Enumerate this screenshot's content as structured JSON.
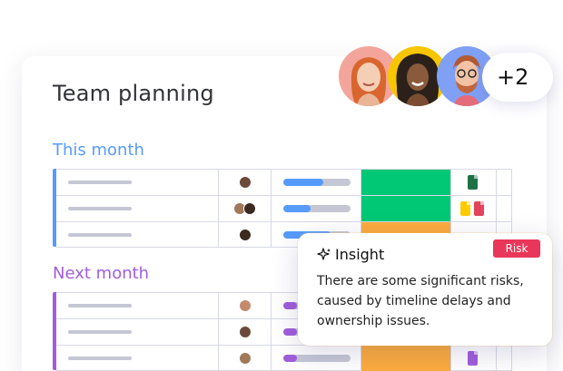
{
  "board": {
    "title": "Team planning"
  },
  "team": {
    "extra_count": "+2",
    "members": [
      {
        "icon": "woman-redhead-avatar",
        "bg": "#f3a59c"
      },
      {
        "icon": "woman-curly-avatar",
        "bg": "#f7c600"
      },
      {
        "icon": "man-glasses-avatar",
        "bg": "#7fa0f5"
      }
    ]
  },
  "groups": [
    {
      "label": "This month",
      "accent": "#579bfc",
      "rows": [
        {
          "owners": 1,
          "progress": 0.6,
          "progress_color": "#579bfc",
          "status_color": "#00c875",
          "files": [
            "#1e7145"
          ]
        },
        {
          "owners": 2,
          "progress": 0.4,
          "progress_color": "#579bfc",
          "status_color": "#00c875",
          "files": [
            "#ffcb00",
            "#e2445c"
          ]
        },
        {
          "owners": 1,
          "progress": 0.7,
          "progress_color": "#579bfc",
          "status_color": "#fdab3d",
          "files": []
        }
      ]
    },
    {
      "label": "Next month",
      "accent": "#a25ddc",
      "rows": [
        {
          "owners": 1,
          "progress": 0.2,
          "progress_color": "#a25ddc",
          "status_color": "#ffffff",
          "files": []
        },
        {
          "owners": 1,
          "progress": 0.2,
          "progress_color": "#a25ddc",
          "status_color": "#ffffff",
          "files": []
        },
        {
          "owners": 1,
          "progress": 0.2,
          "progress_color": "#a25ddc",
          "status_color": "#fdab3d",
          "files": [
            "#a25ddc"
          ]
        }
      ]
    }
  ],
  "insight": {
    "icon": "sparkle-icon",
    "title": "Insight",
    "badge": "Risk",
    "badge_color": "#e8375a",
    "body": "There are some significant risks, caused by timeline delays and ownership issues."
  }
}
